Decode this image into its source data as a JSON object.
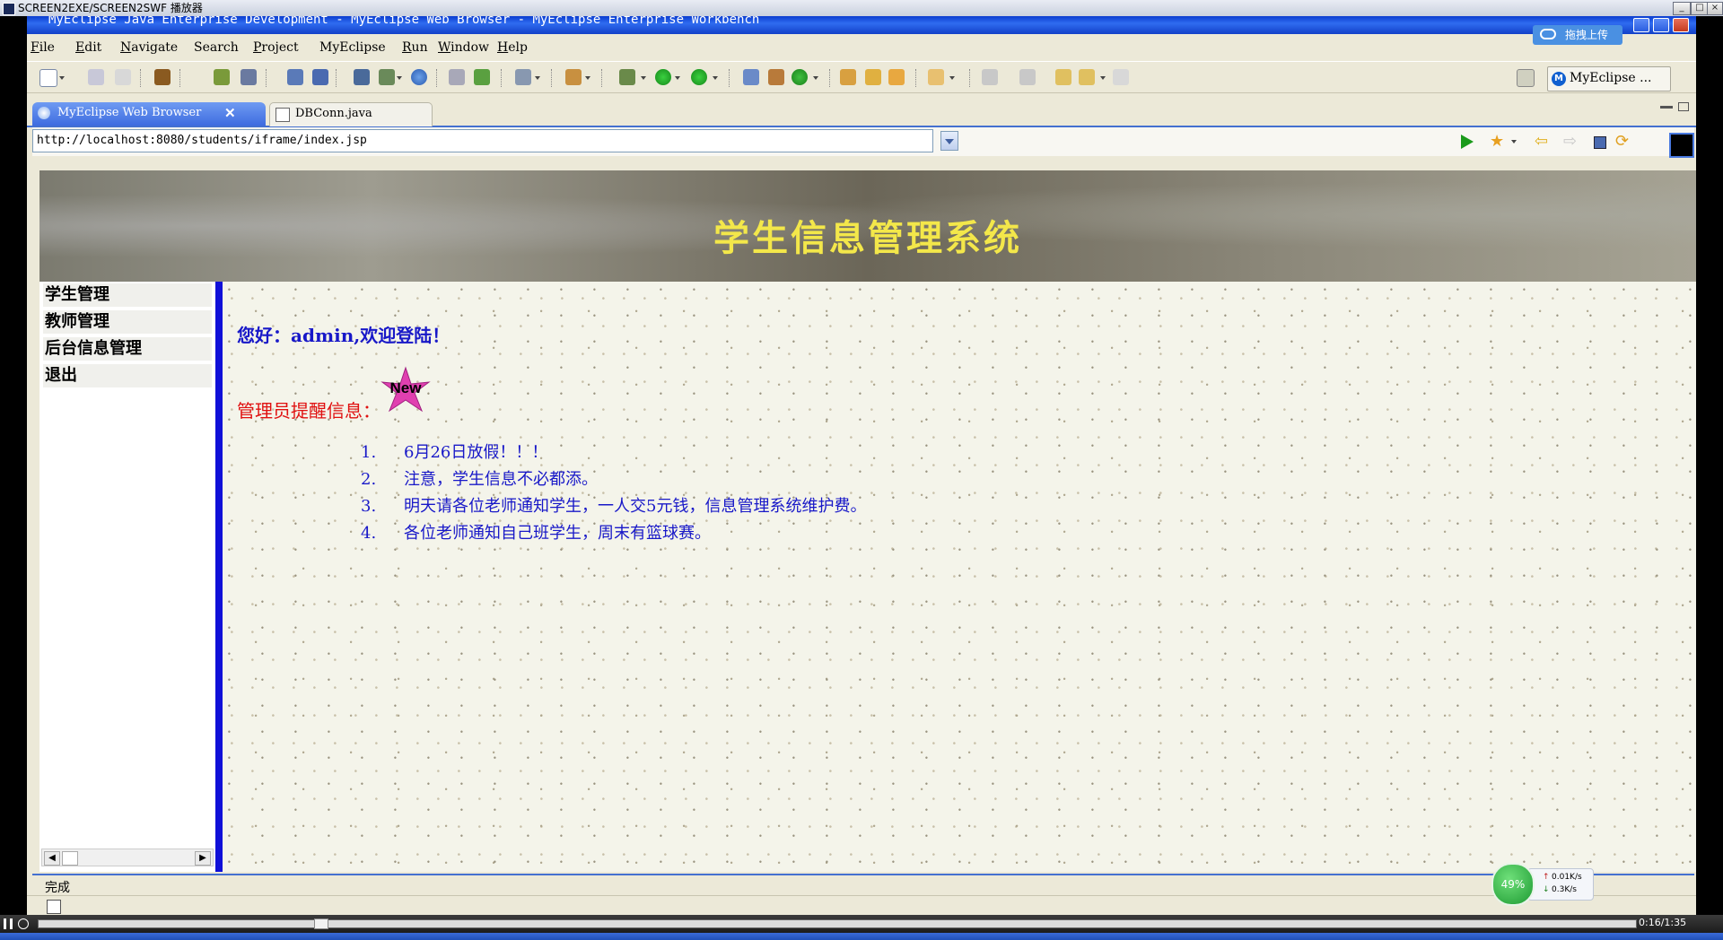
{
  "player": {
    "title": "SCREEN2EXE/SCREEN2SWF 播放器",
    "time": "0:16/1:35"
  },
  "eclipse": {
    "title": "MyEclipse Java Enterprise Development - MyEclipse Web Browser - MyEclipse Enterprise Workbench",
    "cloud_upload": "拖拽上传",
    "menu": [
      {
        "key": "F",
        "rest": "ile"
      },
      {
        "key": "E",
        "rest": "dit"
      },
      {
        "key": "N",
        "rest": "avigate"
      },
      {
        "key": "",
        "rest": "Search"
      },
      {
        "key": "P",
        "rest": "roject"
      },
      {
        "key": "",
        "rest": "MyEclipse"
      },
      {
        "key": "R",
        "rest": "un"
      },
      {
        "key": "W",
        "rest": "indow"
      },
      {
        "key": "H",
        "rest": "elp"
      }
    ],
    "perspective": "MyEclipse ...",
    "tabs": [
      {
        "label": "MyEclipse Web Browser",
        "close": "✕"
      },
      {
        "label": "DBConn.java"
      }
    ],
    "address": "http://localhost:8080/students/iframe/index.jsp",
    "status": "完成"
  },
  "web": {
    "banner_title": "学生信息管理系统",
    "sidebar": [
      "学生管理",
      "教师管理",
      "后台信息管理",
      "退出"
    ],
    "welcome": "您好：admin,欢迎登陆！",
    "notice_label": "管理员提醒信息：",
    "new_badge": "New",
    "notices": [
      {
        "num": "1.",
        "text": "6月26日放假！！！"
      },
      {
        "num": "2.",
        "text": "注意，学生信息不必都添。"
      },
      {
        "num": "3.",
        "text": "明天请各位老师通知学生，一人交5元钱，信息管理系统维护费。"
      },
      {
        "num": "4.",
        "text": "各位老师通知自己班学生，周末有篮球赛。"
      }
    ]
  },
  "net_widget": {
    "percent": "49%",
    "up": "0.01K/s",
    "down": "0.3K/s"
  },
  "colors": {
    "banner_title": "#f3e74a",
    "welcome": "#1818c8",
    "notice_label": "#e01010",
    "sidebar_edge": "#1010d8"
  }
}
